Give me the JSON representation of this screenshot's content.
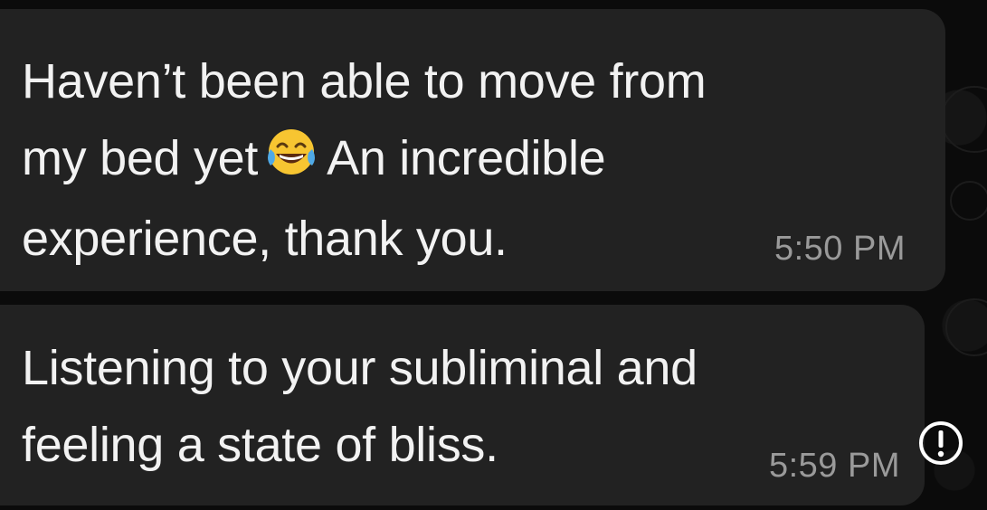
{
  "messages": [
    {
      "text_before_emoji": "Haven’t been able to move from\nmy bed yet",
      "emoji": "face-with-tears-of-joy-icon",
      "text_after_emoji": "An incredible\nexperience, thank you.",
      "time": "5:50 PM"
    },
    {
      "text": "Listening to your subliminal and\nfeeling a state of bliss.",
      "time": "5:59 PM",
      "status_icon": "error-exclamation-icon"
    }
  ],
  "colors": {
    "background": "#0b0b0b",
    "bubble": "#222222",
    "text": "#f2f2f2",
    "time": "#9a9a9a",
    "alert": "#ffffff"
  }
}
